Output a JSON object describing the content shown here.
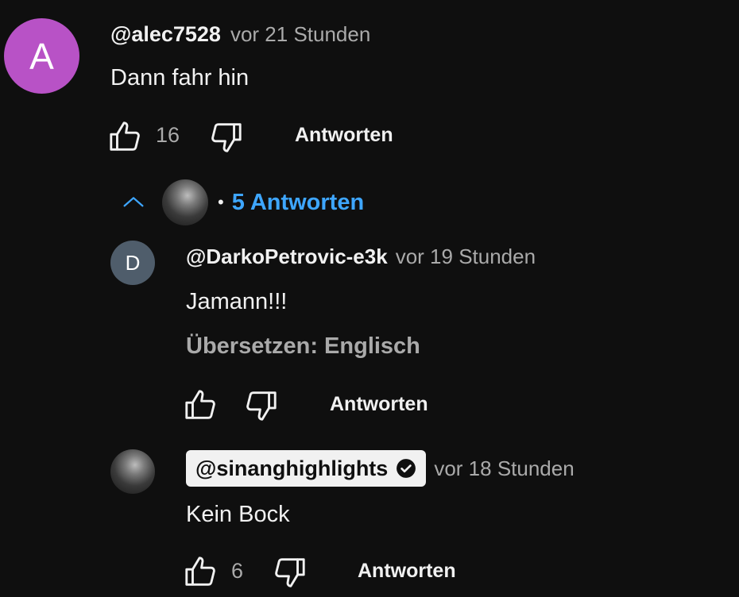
{
  "comment": {
    "avatar_letter": "A",
    "avatar_color": "#b852c6",
    "username": "@alec7528",
    "time": "vor 21 Stunden",
    "text": "Dann fahr hin",
    "likes": "16",
    "reply_label": "Antworten",
    "replies_toggle": {
      "separator": "•",
      "label": "5 Antworten",
      "color": "#3ea6ff"
    }
  },
  "replies": [
    {
      "avatar_letter": "D",
      "avatar_color": "#4f5d6b",
      "username": "@DarkoPetrovic-e3k",
      "time": "vor 19 Stunden",
      "text": "Jamann!!!",
      "translate": "Übersetzen: Englisch",
      "likes": "",
      "reply_label": "Antworten"
    },
    {
      "username": "@sinanghighlights",
      "verified": true,
      "time": "vor 18 Stunden",
      "text": "Kein Bock",
      "likes": "6",
      "reply_label": "Antworten"
    }
  ],
  "icons": {
    "like": "thumbs-up-icon",
    "dislike": "thumbs-down-icon",
    "collapse": "chevron-up-icon",
    "verified": "verified-check-icon"
  }
}
